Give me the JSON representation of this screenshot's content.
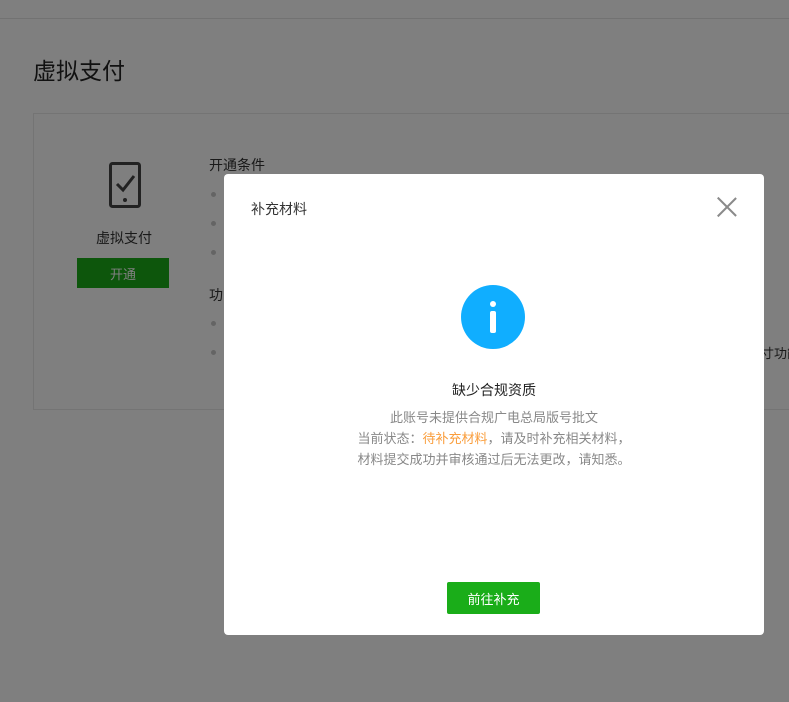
{
  "page": {
    "title": "虚拟支付"
  },
  "feature": {
    "icon": "phone-check-icon",
    "name": "虚拟支付",
    "open_button": "开通",
    "conditions_title": "开通条件",
    "functions_title_partial": "功",
    "right_cut_text": "寸功能"
  },
  "dialog": {
    "title": "补充材料",
    "close_icon": "close-icon",
    "info_icon": "info-icon",
    "message_title": "缺少合规资质",
    "line1": "此账号未提供合规广电总局版号批文",
    "line2_prefix": "当前状态：",
    "line2_status": "待补充材料",
    "line2_suffix": "，请及时补充相关材料，",
    "line3": "材料提交成功并审核通过后无法更改，请知悉。",
    "primary_button": "前往补充"
  },
  "colors": {
    "primary_green": "#1aad19",
    "info_blue": "#10aeff",
    "warning_orange": "#fa9d3b"
  }
}
